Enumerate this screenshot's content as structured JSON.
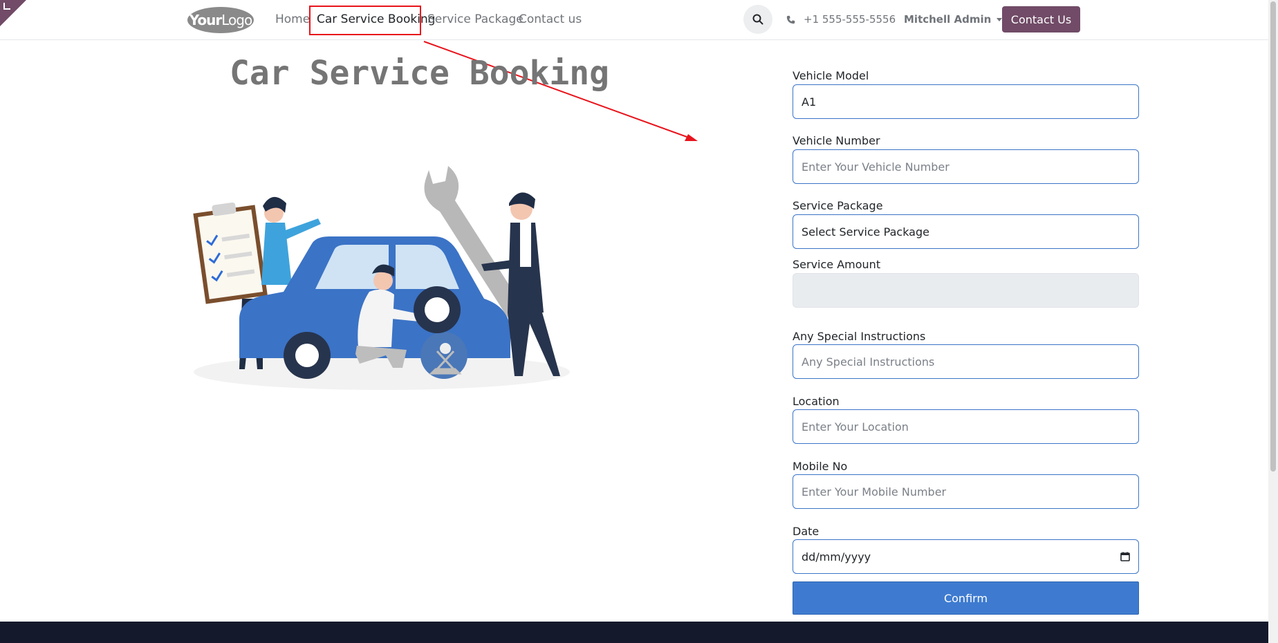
{
  "brand": {
    "logo_your": "Your",
    "logo_logo": "Logo",
    "accent_color": "#714b67"
  },
  "nav": {
    "items": [
      {
        "label": "Home"
      },
      {
        "label": "Car Service Booking",
        "active": true
      },
      {
        "label": "Service Package"
      },
      {
        "label": "Contact us"
      }
    ],
    "phone": "+1 555-555-5556",
    "user": "Mitchell Admin",
    "contact_button": "Contact Us"
  },
  "page": {
    "title": "Car Service Booking"
  },
  "form": {
    "vehicle_model": {
      "label": "Vehicle Model",
      "value": "A1"
    },
    "vehicle_number": {
      "label": "Vehicle Number",
      "placeholder": "Enter Your Vehicle Number"
    },
    "service_package": {
      "label": "Service Package",
      "value": "Select Service Package"
    },
    "service_amount": {
      "label": "Service Amount",
      "value": ""
    },
    "special_instructions": {
      "label": "Any Special Instructions",
      "placeholder": "Any Special Instructions"
    },
    "location": {
      "label": "Location",
      "placeholder": "Enter Your Location"
    },
    "mobile": {
      "label": "Mobile No",
      "placeholder": "Enter Your Mobile Number"
    },
    "date": {
      "label": "Date",
      "placeholder": "dd/mm/yyyy"
    },
    "confirm_label": "Confirm"
  },
  "icons": {
    "search": "search-icon",
    "phone": "phone-icon",
    "calendar": "calendar-icon",
    "annotation": "red-arrow-annotation"
  }
}
